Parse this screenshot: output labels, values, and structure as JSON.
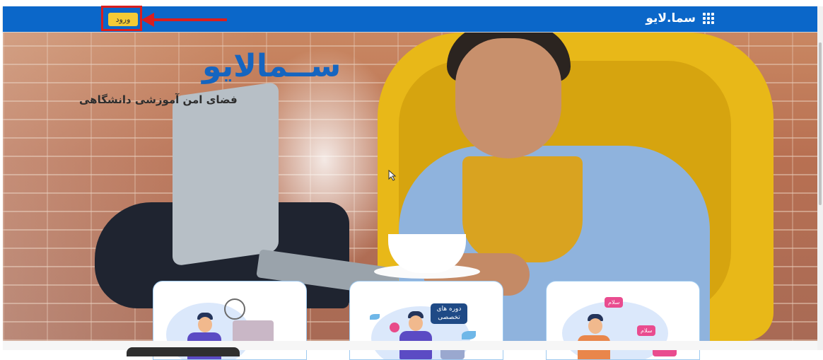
{
  "header": {
    "brand_name": "سما.لایو",
    "apps_icon": "apps-grid-icon",
    "login_label": "ورود",
    "background_color": "#0b67c9",
    "login_color": "#f4cb35"
  },
  "annotation": {
    "highlight_color": "#d91e1e"
  },
  "hero": {
    "logo_text": "ســمالایو",
    "tagline": "فضای امن آموزشی دانشگاهی",
    "logo_color": "#1565c0"
  },
  "cards": [
    {
      "icon": "science-tools-illustration"
    },
    {
      "badge": "دوره های تخصصی",
      "icon": "specialized-courses-illustration"
    },
    {
      "bubble_1": "سلام",
      "bubble_2": "سلام",
      "icon": "greeting-chat-illustration"
    }
  ]
}
